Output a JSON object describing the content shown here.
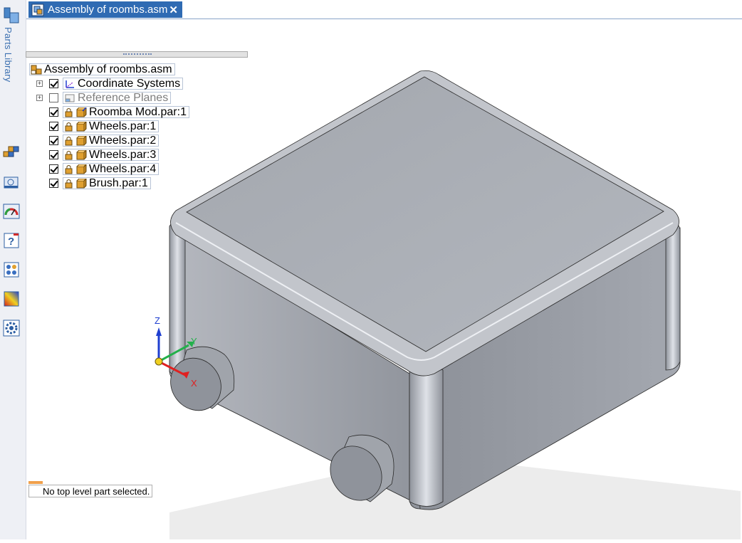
{
  "document_tab": {
    "title": "Assembly of roombs.asm",
    "close_glyph": "✕"
  },
  "sidebar": {
    "label": "Parts Library",
    "tools": [
      {
        "name": "assembly-tool-icon"
      },
      {
        "name": "display-config-icon"
      },
      {
        "name": "gauge-icon"
      },
      {
        "name": "help-icon"
      },
      {
        "name": "layout-icon"
      },
      {
        "name": "color-gradient-icon"
      },
      {
        "name": "gear-settings-icon"
      }
    ]
  },
  "tree": {
    "root": "Assembly of roombs.asm",
    "items": [
      {
        "label": "Coordinate Systems",
        "checked": true,
        "expandable": true,
        "icon": "coordinate-system-icon"
      },
      {
        "label": "Reference Planes",
        "checked": false,
        "expandable": true,
        "icon": "reference-plane-icon"
      },
      {
        "label": "Roomba Mod.par:1",
        "checked": true,
        "expandable": false,
        "icon": "part-icon"
      },
      {
        "label": "Wheels.par:1",
        "checked": true,
        "expandable": false,
        "icon": "part-icon"
      },
      {
        "label": "Wheels.par:2",
        "checked": true,
        "expandable": false,
        "icon": "part-icon"
      },
      {
        "label": "Wheels.par:3",
        "checked": true,
        "expandable": false,
        "icon": "part-icon"
      },
      {
        "label": "Wheels.par:4",
        "checked": true,
        "expandable": false,
        "icon": "part-icon"
      },
      {
        "label": "Brush.par:1",
        "checked": true,
        "expandable": false,
        "icon": "part-icon"
      }
    ]
  },
  "status": {
    "message": "No top level part selected."
  },
  "triad": {
    "z": "Z",
    "y": "Y",
    "x": "X"
  },
  "colors": {
    "tab_bg": "#2f6bb3",
    "model_face": "#a9adb4",
    "axis_x": "#e02020",
    "axis_y": "#22b04a",
    "axis_z": "#1f3fd0"
  }
}
